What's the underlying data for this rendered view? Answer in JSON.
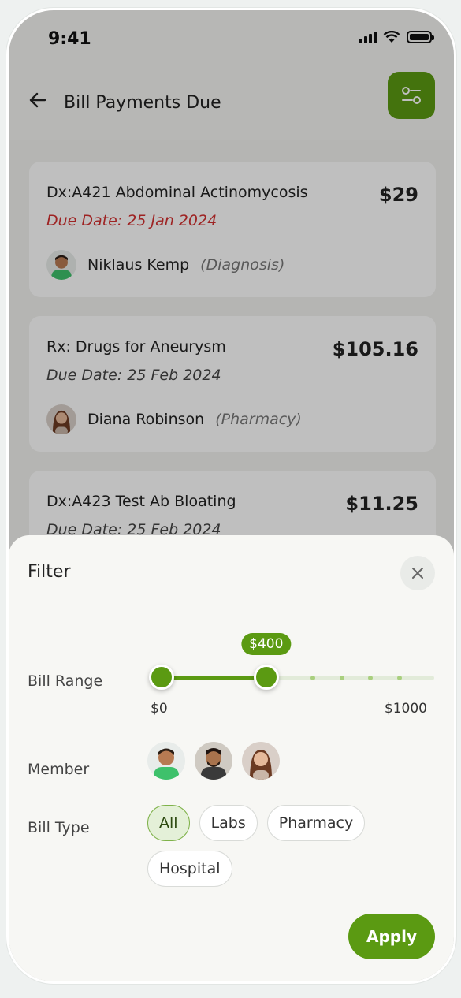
{
  "status_bar": {
    "time": "9:41"
  },
  "header": {
    "title": "Bill Payments Due",
    "back_icon": "arrow-left-icon",
    "filter_icon": "sliders-icon"
  },
  "bills": [
    {
      "name": "Dx:A421 Abdominal Actinomycosis",
      "amount": "$29",
      "due": "Due Date: 25 Jan 2024",
      "overdue": true,
      "person": "Niklaus Kemp",
      "role": "(Diagnosis)"
    },
    {
      "name": "Rx: Drugs for Aneurysm",
      "amount": "$105.16",
      "due": "Due Date: 25 Feb 2024",
      "overdue": false,
      "person": "Diana Robinson",
      "role": "(Pharmacy)"
    },
    {
      "name": "Dx:A423 Test Ab Bloating",
      "amount": "$11.25",
      "due": "Due Date: 25 Feb 2024",
      "overdue": false
    }
  ],
  "filter": {
    "title": "Filter",
    "bill_range": {
      "label": "Bill Range",
      "min": 0,
      "max": 1000,
      "value": 400,
      "min_label": "$0",
      "max_label": "$1000",
      "value_label": "$400"
    },
    "member": {
      "label": "Member"
    },
    "bill_type": {
      "label": "Bill Type",
      "options": [
        "All",
        "Labs",
        "Pharmacy",
        "Hospital"
      ],
      "selected": "All"
    },
    "apply_label": "Apply"
  },
  "colors": {
    "accent": "#5b9a12",
    "overdue": "#d32f2f",
    "chip_active_bg": "#e4f0d8"
  }
}
